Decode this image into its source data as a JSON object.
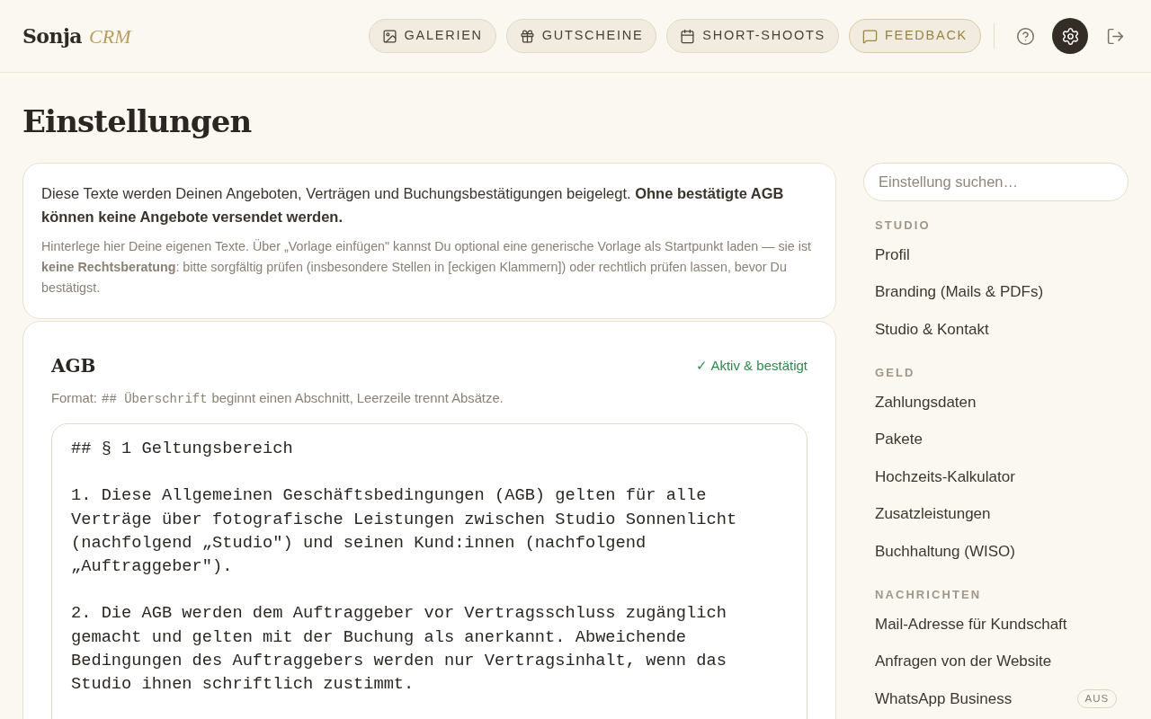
{
  "logo": {
    "name": "Sonja",
    "suffix": "CRM"
  },
  "nav": [
    {
      "label": "GALERIEN",
      "accent": false
    },
    {
      "label": "GUTSCHEINE",
      "accent": false
    },
    {
      "label": "SHORT-SHOOTS",
      "accent": false
    },
    {
      "label": "FEEDBACK",
      "accent": true
    }
  ],
  "icon_buttons": [
    {
      "selected": false
    },
    {
      "selected": true
    },
    {
      "selected": false
    }
  ],
  "page_title": "Einstellungen",
  "intro": {
    "text": "Diese Texte werden Deinen Angeboten, Verträgen und Buchungsbestätigungen beigelegt. **Ohne bestätigte AGB können keine Angebote versendet werden.**",
    "note": "Hinterlege hier Deine eigenen Texte. Über „Vorlage einfügen\" kannst Du optional eine generische Vorlage als Startpunkt laden — sie ist **keine Rechtsberatung**: bitte sorgfältig prüfen (insbesondere Stellen in [eckigen Klammern]) oder rechtlich prüfen lassen, bevor Du bestätigst."
  },
  "document": {
    "title": "AGB",
    "status": "✓ Aktiv & bestätigt",
    "confirmed": true,
    "format_prefix": "Format:",
    "format_code": "## Überschrift",
    "format_suffix": "beginnt einen Abschnitt, Leerzeile trennt Absätze.",
    "paragraphs": [
      [
        "## § 1 Geltungsbereich"
      ],
      [
        "1. Diese Allgemeinen Geschäftsbedingungen (AGB) gelten für alle",
        "Verträge über fotografische Leistungen zwischen Studio Sonnenlicht",
        "(nachfolgend „Studio\") und seinen Kund:innen (nachfolgend",
        "„Auftraggeber\")."
      ],
      [
        "2. Die AGB werden dem Auftraggeber vor Vertragsschluss zugänglich",
        "gemacht und gelten mit der Buchung als anerkannt. Abweichende",
        "Bedingungen des Auftraggebers werden nur Vertragsinhalt, wenn das",
        "Studio ihnen schriftlich zustimmt."
      ]
    ]
  },
  "sidebar": {
    "search_placeholder": "Einstellung suchen…",
    "groups": [
      {
        "title": "STUDIO",
        "items": [
          {
            "label": "Profil"
          },
          {
            "label": "Branding (Mails & PDFs)"
          },
          {
            "label": "Studio & Kontakt"
          }
        ]
      },
      {
        "title": "GELD",
        "items": [
          {
            "label": "Zahlungsdaten"
          },
          {
            "label": "Pakete"
          },
          {
            "label": "Hochzeits-Kalkulator"
          },
          {
            "label": "Zusatzleistungen"
          },
          {
            "label": "Buchhaltung (WISO)"
          }
        ]
      },
      {
        "title": "NACHRICHTEN",
        "items": [
          {
            "label": "Mail-Adresse für Kundschaft"
          },
          {
            "label": "Anfragen von der Website"
          },
          {
            "label": "WhatsApp Business",
            "badge": "AUS"
          }
        ]
      }
    ]
  }
}
